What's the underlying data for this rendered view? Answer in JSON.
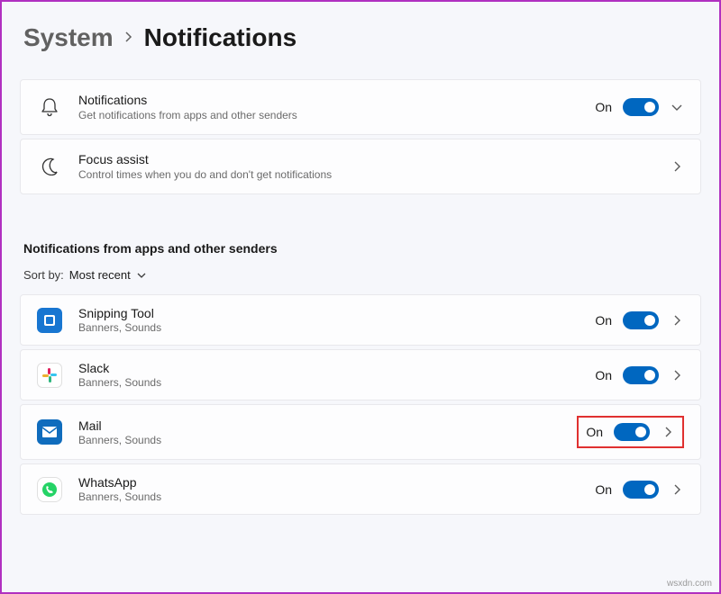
{
  "breadcrumb": {
    "parent": "System",
    "current": "Notifications"
  },
  "notifications_card": {
    "title": "Notifications",
    "sub": "Get notifications from apps and other senders",
    "state": "On"
  },
  "focus_card": {
    "title": "Focus assist",
    "sub": "Control times when you do and don't get notifications"
  },
  "section_header": "Notifications from apps and other senders",
  "sort": {
    "label": "Sort by:",
    "value": "Most recent"
  },
  "apps": [
    {
      "name": "Snipping Tool",
      "sub": "Banners, Sounds",
      "state": "On",
      "icon": "snip",
      "highlight": false
    },
    {
      "name": "Slack",
      "sub": "Banners, Sounds",
      "state": "On",
      "icon": "slack",
      "highlight": false
    },
    {
      "name": "Mail",
      "sub": "Banners, Sounds",
      "state": "On",
      "icon": "mail",
      "highlight": true
    },
    {
      "name": "WhatsApp",
      "sub": "Banners, Sounds",
      "state": "On",
      "icon": "whatsapp",
      "highlight": false
    }
  ],
  "watermark": "wsxdn.com"
}
